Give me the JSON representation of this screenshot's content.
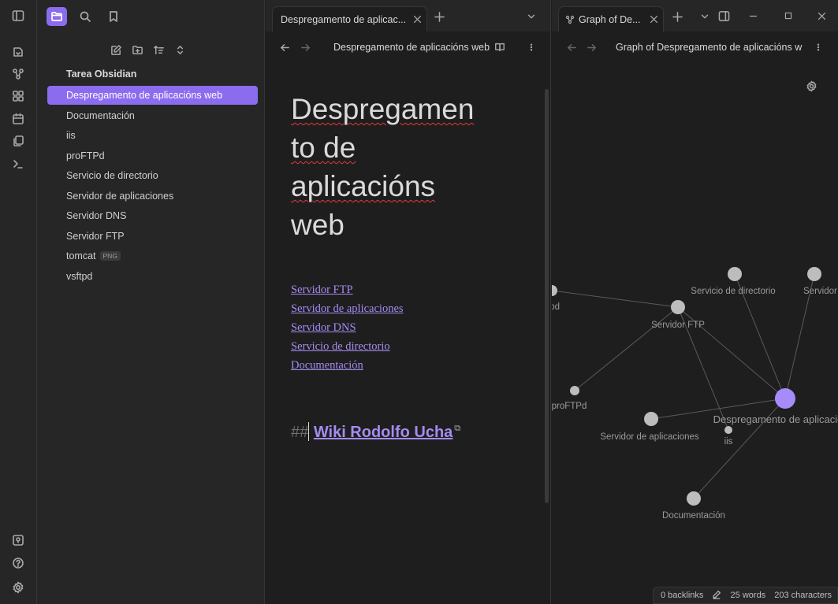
{
  "sidebar": {
    "vault_name": "Tarea Obsidian",
    "files": [
      {
        "name": "Despregamento de aplicacións web",
        "badge": ""
      },
      {
        "name": "Documentación",
        "badge": ""
      },
      {
        "name": "iis",
        "badge": ""
      },
      {
        "name": "proFTPd",
        "badge": ""
      },
      {
        "name": "Servicio de directorio",
        "badge": ""
      },
      {
        "name": "Servidor de aplicaciones",
        "badge": ""
      },
      {
        "name": "Servidor DNS",
        "badge": ""
      },
      {
        "name": "Servidor FTP",
        "badge": ""
      },
      {
        "name": "tomcat",
        "badge": "PNG"
      },
      {
        "name": "vsftpd",
        "badge": ""
      }
    ],
    "active_index": 0
  },
  "tabs": {
    "left_tab_title": "Despregamento de aplicac...",
    "right_tab_title": "Graph of De..."
  },
  "editor": {
    "nav_title": "Despregamento de aplicacións web",
    "heading_parts": [
      "Despregamen",
      "to de",
      "aplicacións",
      "web"
    ],
    "links": [
      "Servidor FTP",
      "Servidor de aplicaciones",
      "Servidor DNS",
      "Servicio de directorio",
      "Documentación"
    ],
    "h2_marker": "##",
    "h2_link": "Wiki Rodolfo Ucha"
  },
  "graph": {
    "nav_title": "Graph of Despregamento de aplicacións w",
    "nodes": [
      {
        "label": "Servicio de directorio"
      },
      {
        "label": "Servidor DN"
      },
      {
        "label": ":pd"
      },
      {
        "label": "Servidor FTP"
      },
      {
        "label": "proFTPd"
      },
      {
        "label": "Despregamento de aplicació"
      },
      {
        "label": "Servidor de aplicaciones"
      },
      {
        "label": "iis"
      },
      {
        "label": "Documentación"
      }
    ],
    "active_color": "#a78bfa",
    "node_color": "#bdbdbd"
  },
  "status_bar": {
    "backlinks": "0 backlinks",
    "words": "25 words",
    "characters": "203 characters"
  },
  "icons": {
    "ribbon": [
      "sidebar-toggle-icon",
      "quick-switcher-icon",
      "graph-view-icon",
      "canvas-icon",
      "daily-note-icon",
      "templates-icon",
      "command-palette-icon",
      "vault-switcher-icon",
      "help-icon",
      "settings-icon"
    ]
  },
  "colors": {
    "accent": "#8b6cef",
    "link": "#a58bf2",
    "spellcheck": "#e23a3a"
  }
}
